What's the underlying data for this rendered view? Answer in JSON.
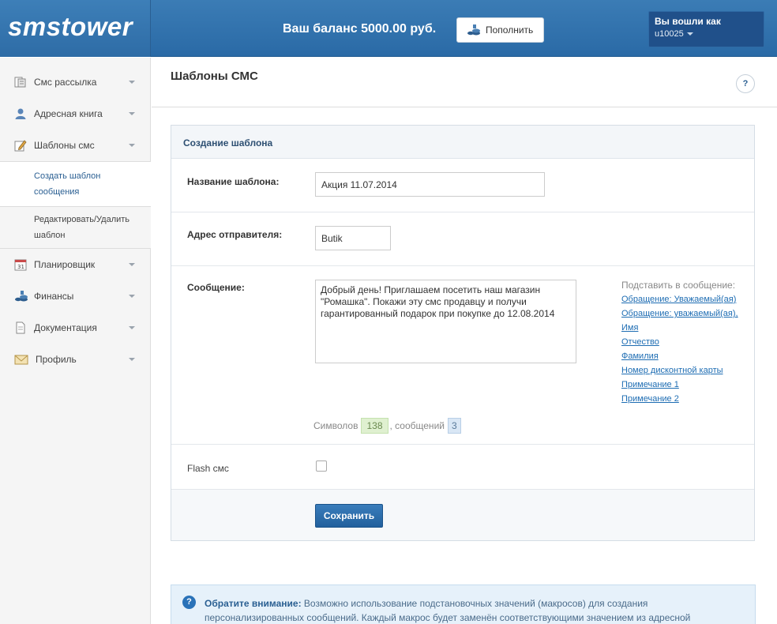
{
  "header": {
    "logo": "smstower",
    "balance": "Ваш баланс 5000.00 руб.",
    "topup_label": "Пополнить",
    "user_title": "Вы вошли как",
    "user_name": "u10025"
  },
  "sidebar": {
    "items": [
      {
        "label": "Смс рассылка",
        "icon": "sms-list-icon"
      },
      {
        "label": "Адресная книга",
        "icon": "person-icon"
      },
      {
        "label": "Шаблоны смс",
        "icon": "pencil-note-icon"
      },
      {
        "label": "Планировщик",
        "icon": "calendar-icon"
      },
      {
        "label": "Финансы",
        "icon": "coins-icon"
      },
      {
        "label": "Документация",
        "icon": "document-icon"
      },
      {
        "label": "Профиль",
        "icon": "envelope-icon"
      }
    ],
    "sub_create": "Создать шаблон сообщения",
    "sub_edit": "Редактировать/Удалить шаблон"
  },
  "page": {
    "title": "Шаблоны СМС",
    "help_label": "?"
  },
  "form": {
    "panel_title": "Создание шаблона",
    "name_label": "Название шаблона:",
    "name_value": "Акция 11.07.2014",
    "sender_label": "Адрес отправителя:",
    "sender_value": "Butik",
    "message_label": "Сообщение:",
    "message_value": "Добрый день! Приглашаем посетить наш магазин \"Ромашка\". Покажи эту смс продавцу и получи гарантированный подарок при покупке до 12.08.2014",
    "macro_title": "Подставить в сообщение:",
    "macros": [
      "Обращение: Уважаемый(ая)",
      "Обращение: уважаемый(ая),",
      "Имя",
      "Отчество",
      "Фамилия",
      "Номер дисконтной карты",
      "Примечание 1",
      "Примечание 2"
    ],
    "symbols_label": "Символов",
    "symbols_count": "138",
    "messages_label": ", сообщений",
    "messages_count": "3",
    "flash_label": "Flash смс",
    "flash_checked": false,
    "save_label": "Сохранить"
  },
  "notice": {
    "icon": "question-icon",
    "bold": "Обратите внимание:",
    "text": " Возможно использование подстановочных значений (макросов) для создания персонализированных сообщений. Каждый макрос будет заменён соответствующими значением из адресной"
  },
  "colors": {
    "header_blue": "#2a6aa6",
    "link_blue": "#1e6db3",
    "button_blue": "#22609d"
  }
}
